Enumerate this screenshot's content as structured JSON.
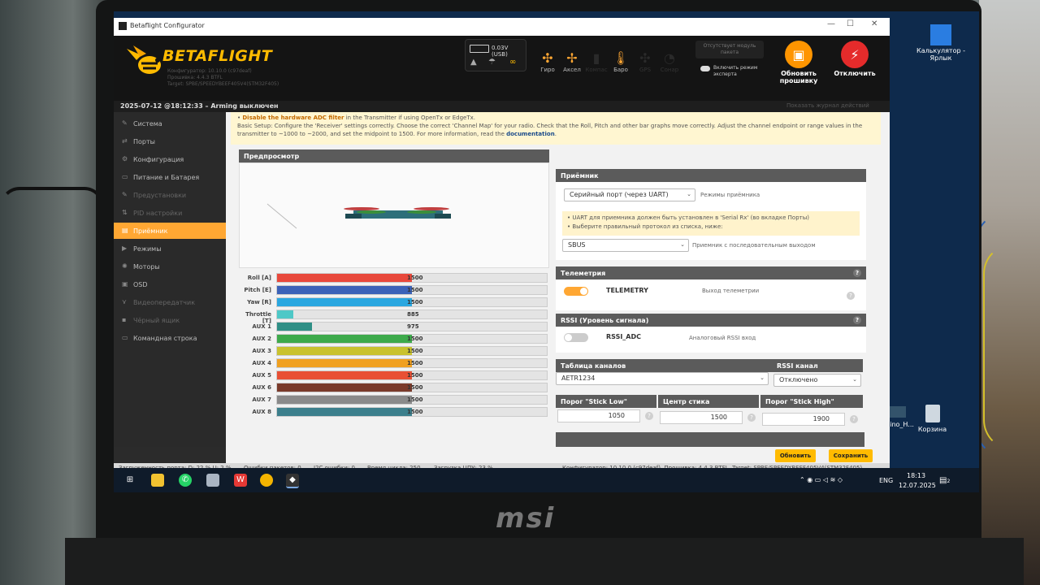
{
  "window": {
    "title": "Betaflight Configurator",
    "minimize": "—",
    "maximize": "☐",
    "close": "✕"
  },
  "header": {
    "logo_text": "BETAFLIGHT",
    "logo_sub": [
      "Конфигуратор: 10.10.0 (c97deaf)",
      "Прошивка: 4.4.3 BTFL",
      "Target: SPBE/SPEEDYBEEF405V4(STM32F405)"
    ],
    "battery": "0.03V (USB)",
    "sensors": [
      {
        "label": "Гиро",
        "icon": "gyro-icon",
        "glyph": "✣",
        "active": true
      },
      {
        "label": "Аксел",
        "icon": "accel-icon",
        "glyph": "✢",
        "active": true
      },
      {
        "label": "Компас",
        "icon": "mag-icon",
        "glyph": "▮",
        "active": false
      },
      {
        "label": "Баро",
        "icon": "baro-icon",
        "glyph": "🌡",
        "active": true
      },
      {
        "label": "GPS",
        "icon": "gps-icon",
        "glyph": "✣",
        "active": false
      },
      {
        "label": "Сонар",
        "icon": "sonar-icon",
        "glyph": "◔",
        "active": false
      }
    ],
    "no_packet": "Отсутствует модуль пакета",
    "expert_mode": "Включить режим эксперта",
    "update_btn": "Обновить прошивку",
    "disconnect_btn": "Отключить",
    "update_hint": "Показать журнал действий"
  },
  "status_top": "2025-07-12 @18:12:33 – Arming выключен",
  "sidebar": {
    "items": [
      {
        "label": "Система",
        "icon": "wrench-icon",
        "glyph": "✎"
      },
      {
        "label": "Порты",
        "icon": "ports-icon",
        "glyph": "⇄"
      },
      {
        "label": "Конфигурация",
        "icon": "gear-icon",
        "glyph": "⚙"
      },
      {
        "label": "Питание и Батарея",
        "icon": "battery-icon",
        "glyph": "▭"
      },
      {
        "label": "Предустановки",
        "icon": "presets-icon",
        "glyph": "✎"
      },
      {
        "label": "PID настройки",
        "icon": "pid-icon",
        "glyph": "⇅"
      },
      {
        "label": "Приёмник",
        "icon": "receiver-icon",
        "glyph": "▤"
      },
      {
        "label": "Режимы",
        "icon": "modes-icon",
        "glyph": "▶"
      },
      {
        "label": "Моторы",
        "icon": "motors-icon",
        "glyph": "✺"
      },
      {
        "label": "OSD",
        "icon": "osd-icon",
        "glyph": "▣"
      },
      {
        "label": "Видеопередатчик",
        "icon": "vtx-icon",
        "glyph": "⋎"
      },
      {
        "label": "Чёрный ящик",
        "icon": "blackbox-icon",
        "glyph": "▪"
      },
      {
        "label": "Командная строка",
        "icon": "cli-icon",
        "glyph": "▭"
      }
    ]
  },
  "notice": {
    "line1_bold": "Disable the hardware ADC filter",
    "line1_rest": " in the Transmitter if using OpenTx or EdgeTx.",
    "line2": "Basic Setup: Configure the 'Receiver' settings correctly. Choose the correct 'Channel Map' for your radio. Check that the Roll, Pitch and other bar graphs move correctly. Adjust the channel endpoint or range values in the",
    "line3": "transmitter to ~1000 to ~2000, and set the midpoint to 1500. For more information, read the ",
    "link": "documentation"
  },
  "preview": {
    "title": "Предпросмотр"
  },
  "channels": [
    {
      "label": "Roll [A]",
      "value": "1500",
      "fill": 0.5,
      "color": "#e8483b"
    },
    {
      "label": "Pitch [E]",
      "value": "1500",
      "fill": 0.5,
      "color": "#3b62b8"
    },
    {
      "label": "Yaw [R]",
      "value": "1500",
      "fill": 0.5,
      "color": "#2aa7e0"
    },
    {
      "label": "Throttle [T]",
      "value": "885",
      "fill": 0.06,
      "color": "#4ec8c7"
    },
    {
      "label": "AUX 1",
      "value": "975",
      "fill": 0.13,
      "color": "#2f8f86"
    },
    {
      "label": "AUX 2",
      "value": "1500",
      "fill": 0.5,
      "color": "#3daa4b"
    },
    {
      "label": "AUX 3",
      "value": "1500",
      "fill": 0.5,
      "color": "#c9c22e"
    },
    {
      "label": "AUX 4",
      "value": "1500",
      "fill": 0.5,
      "color": "#f0a020"
    },
    {
      "label": "AUX 5",
      "value": "1500",
      "fill": 0.5,
      "color": "#e85035"
    },
    {
      "label": "AUX 6",
      "value": "1500",
      "fill": 0.5,
      "color": "#7a3a2a"
    },
    {
      "label": "AUX 7",
      "value": "1500",
      "fill": 0.5,
      "color": "#8a8a8a"
    },
    {
      "label": "AUX 8",
      "value": "1500",
      "fill": 0.5,
      "color": "#3c7f8c"
    }
  ],
  "receiver": {
    "title": "Приёмник",
    "mode_select": "Серийный порт (через UART)",
    "mode_hint": "Режимы приёмника",
    "note1": "• UART для приемника должен быть установлен в 'Serial Rx' (во вкладке Порты)",
    "note2": "• Выберите правильный протокол из списка, ниже:",
    "provider_select": "SBUS",
    "provider_hint": "Приемник с последовательным выходом"
  },
  "telemetry": {
    "title": "Телеметрия",
    "switch_label": "TELEMETRY",
    "hint": "Выход телеметрии",
    "on": true
  },
  "rssi": {
    "title": "RSSI (Уровень сигнала)",
    "switch_label": "RSSI_ADC",
    "hint": "Аналоговый RSSI вход",
    "on": false
  },
  "channel_map": {
    "title": "Таблица каналов",
    "value": "AETR1234",
    "rssi_title": "RSSI канал",
    "rssi_value": "Отключено"
  },
  "sticks": {
    "low_title": "Порог \"Stick Low\"",
    "low_value": "1050",
    "center_title": "Центр стика",
    "center_value": "1500",
    "high_title": "Порог \"Stick High\"",
    "high_value": "1900"
  },
  "actions": {
    "refresh": "Обновить",
    "save": "Сохранить"
  },
  "status_bottom": {
    "port_load": "Загруженность порта: D: 22 % U: 2 %",
    "packet_errors": "Ошибки пакетов: 0",
    "i2c_errors": "I2C ошибки: 0",
    "cycle": "Время цикла: 250",
    "cpu": "Загрузка ЦПУ: 23 %",
    "version": "Конфигуратор: 10.10.0 (c97deaf), Прошивка: 4.4.3 BTFL, Target: SPBE/SPEEDYBEEF405V4(STM32F405)"
  },
  "desktop": {
    "calc": "Калькулятор - Ярлык",
    "arduino": "duino_H...",
    "trash": "Корзина"
  },
  "taskbar": {
    "lang": "ENG",
    "time": "18:13",
    "date": "12.07.2025",
    "notif": "2"
  },
  "brand": "msi"
}
